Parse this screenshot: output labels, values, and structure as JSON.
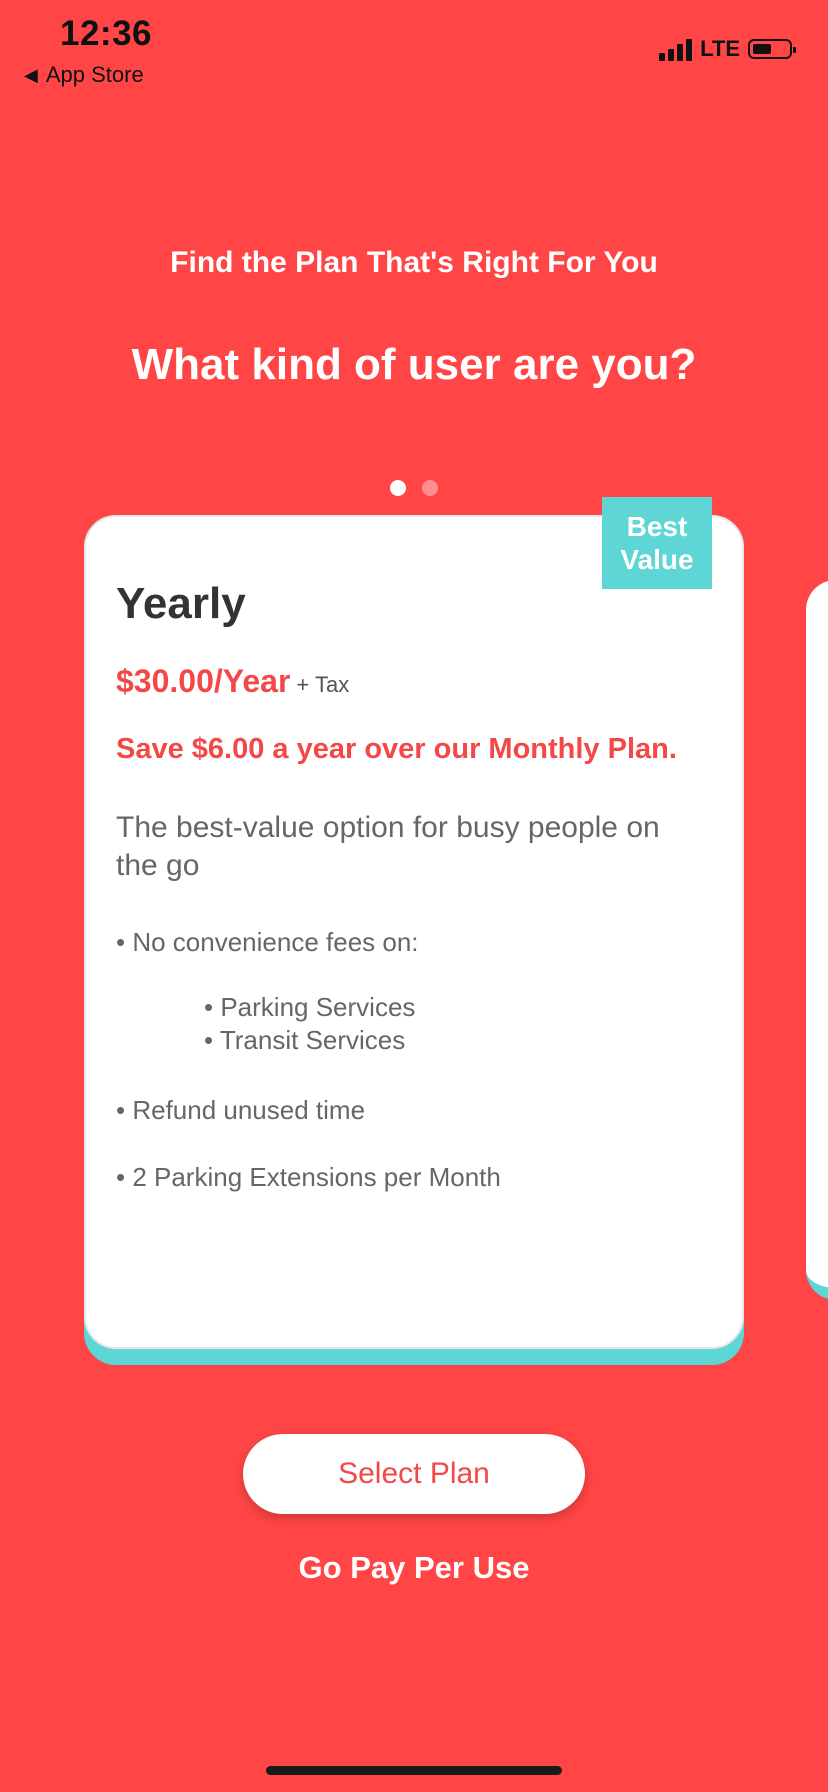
{
  "status": {
    "time": "12:36",
    "back_label": "App Store",
    "network": "LTE"
  },
  "header": {
    "subtitle": "Find the Plan That's Right For You",
    "title": "What kind of user are you?"
  },
  "pager": {
    "count": 2,
    "active_index": 0
  },
  "plan": {
    "badge_line1": "Best",
    "badge_line2": "Value",
    "name": "Yearly",
    "price": "$30.00/Year",
    "tax": "+ Tax",
    "savings": "Save $6.00 a year over our Monthly Plan.",
    "description": "The best-value option for busy people on the go",
    "feature_1": "• No convenience fees on:",
    "sub_feature_1": "• Parking Services",
    "sub_feature_2": "• Transit Services",
    "feature_2": "• Refund unused time",
    "feature_3": "• 2 Parking Extensions per Month"
  },
  "actions": {
    "select_label": "Select Plan",
    "pay_per_use_label": "Go Pay Per Use"
  },
  "colors": {
    "background": "#FF4545",
    "accent_red": "#F24848",
    "accent_teal": "#5ED6D6"
  }
}
